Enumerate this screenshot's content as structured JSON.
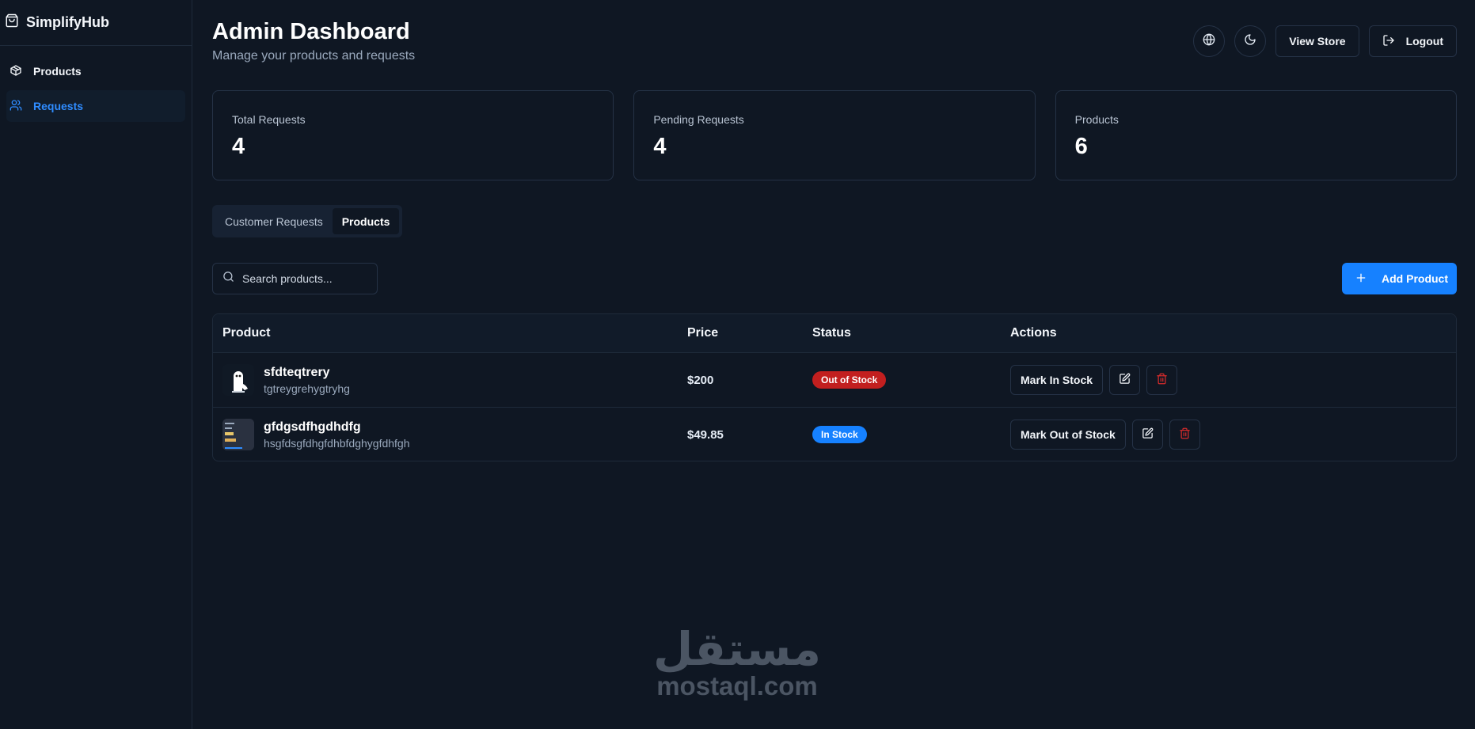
{
  "app": {
    "name": "SimplifyHub"
  },
  "sidebar": {
    "items": [
      {
        "label": "Products",
        "icon": "box-icon",
        "active": false
      },
      {
        "label": "Requests",
        "icon": "users-icon",
        "active": true
      }
    ]
  },
  "header": {
    "title": "Admin Dashboard",
    "subtitle": "Manage your products and requests",
    "view_store_label": "View Store",
    "logout_label": "Logout"
  },
  "stats": [
    {
      "label": "Total Requests",
      "value": "4"
    },
    {
      "label": "Pending Requests",
      "value": "4"
    },
    {
      "label": "Products",
      "value": "6"
    }
  ],
  "tabs": [
    {
      "label": "Customer Requests",
      "active": false
    },
    {
      "label": "Products",
      "active": true
    }
  ],
  "search": {
    "placeholder": "Search products..."
  },
  "add_product_label": "Add Product",
  "table": {
    "headers": {
      "product": "Product",
      "price": "Price",
      "status": "Status",
      "actions": "Actions"
    },
    "rows": [
      {
        "name": "sfdteqtrery",
        "description": "tgtreygrehygtryhg",
        "price": "$200",
        "status": "Out of Stock",
        "toggle_label": "Mark In Stock"
      },
      {
        "name": "gfdgsdfhgdhdfg",
        "description": "hsgfdsgfdhgfdhbfdghygfdhfgh",
        "price": "$49.85",
        "status": "In Stock",
        "toggle_label": "Mark Out of Stock"
      }
    ]
  },
  "watermark": {
    "arabic": "مستقل",
    "latin": "mostaql.com"
  },
  "colors": {
    "background": "#0f1723",
    "accent": "#1681ff",
    "danger": "#c21f1f",
    "border": "#253246"
  }
}
